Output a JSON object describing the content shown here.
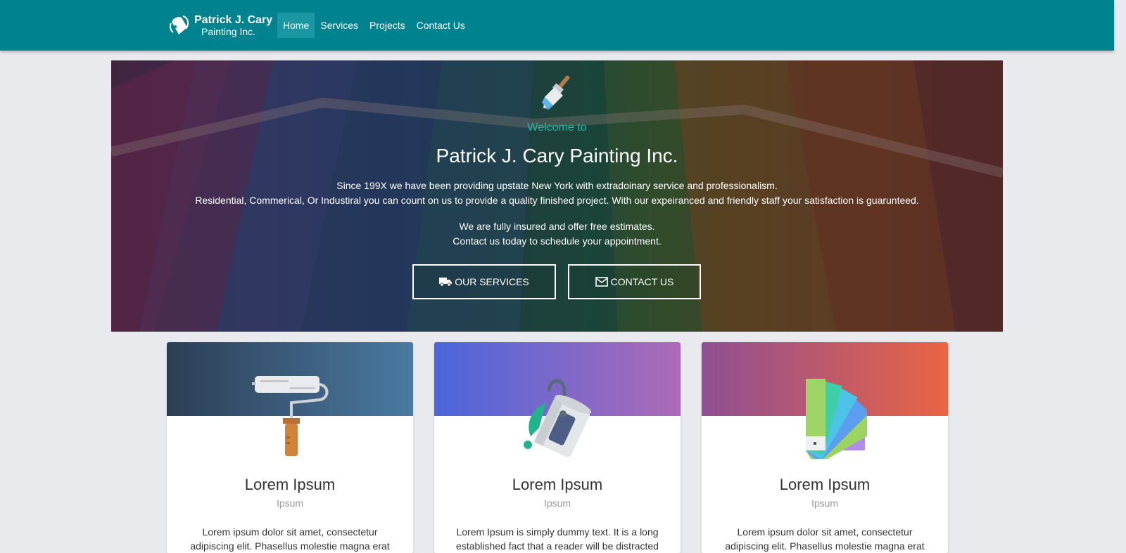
{
  "brand": {
    "line1": "Patrick J. Cary",
    "line2": "Painting Inc."
  },
  "nav": [
    {
      "label": "Home",
      "active": true
    },
    {
      "label": "Services"
    },
    {
      "label": "Projects"
    },
    {
      "label": "Contact Us"
    }
  ],
  "hero": {
    "welcome": "Welcome to",
    "title": "Patrick J. Cary Painting Inc.",
    "line1": "Since 199X we have been providing upstate New York with extradoinary service and professionalism.",
    "line2": "Residential, Commerical, Or Industiral you can count on us to provide a quality finished project. With our expeiranced and friendly staff your satisfaction is guarunteed.",
    "line3": "We are fully insured and offer free estimates.",
    "line4": "Contact us today to schedule your appointment.",
    "btn_services": "OUR SERVICES",
    "btn_contact": "CONTACT US"
  },
  "cards": [
    {
      "title": "Lorem Ipsum",
      "subtitle": "Ipsum",
      "text": "Lorem ipsum dolor sit amet, consectetur adipiscing elit. Phasellus molestie magna erat"
    },
    {
      "title": "Lorem Ipsum",
      "subtitle": "Ipsum",
      "text": "Lorem Ipsum is simply dummy text. It is a long established fact that a reader will be distracted"
    },
    {
      "title": "Lorem Ipsum",
      "subtitle": "Ipsum",
      "text": "Lorem ipsum dolor sit amet, consectetur adipiscing elit. Phasellus molestie magna erat"
    }
  ],
  "colors": {
    "navbar": "#00838f",
    "accent": "#1db9a6",
    "card1_gradient": [
      "#2c3e55",
      "#4a7aa2"
    ],
    "card2_gradient": [
      "#4a66db",
      "#ad6ab8"
    ],
    "card3_gradient": [
      "#8f4f93",
      "#ea6444"
    ]
  },
  "icons": [
    "paint-bucket-logo-icon",
    "paint-brush-icon",
    "truck-icon",
    "envelope-icon",
    "paint-roller-icon",
    "paint-can-icon",
    "color-swatch-icon"
  ]
}
